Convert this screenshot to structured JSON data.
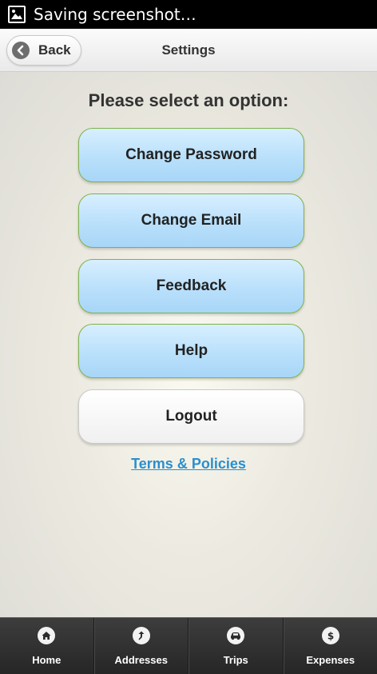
{
  "status_bar": {
    "text": "Saving screenshot…",
    "icon": "screenshot-icon"
  },
  "header": {
    "back_label": "Back",
    "back_icon": "back-arrow-icon",
    "title": "Settings"
  },
  "main": {
    "prompt": "Please select an option:",
    "options": [
      {
        "label": "Change Password"
      },
      {
        "label": "Change Email"
      },
      {
        "label": "Feedback"
      },
      {
        "label": "Help"
      },
      {
        "label": "Logout"
      }
    ],
    "terms_link": "Terms & Policies"
  },
  "bottom_nav": {
    "items": [
      {
        "label": "Home",
        "icon": "home-icon"
      },
      {
        "label": "Addresses",
        "icon": "addresses-icon"
      },
      {
        "label": "Trips",
        "icon": "car-icon"
      },
      {
        "label": "Expenses",
        "icon": "dollar-icon"
      }
    ]
  },
  "colors": {
    "option_blue": "#b9e0fb",
    "option_border": "#7fb24c",
    "link": "#2a8fce",
    "nav_background": "#2f2f2f"
  }
}
